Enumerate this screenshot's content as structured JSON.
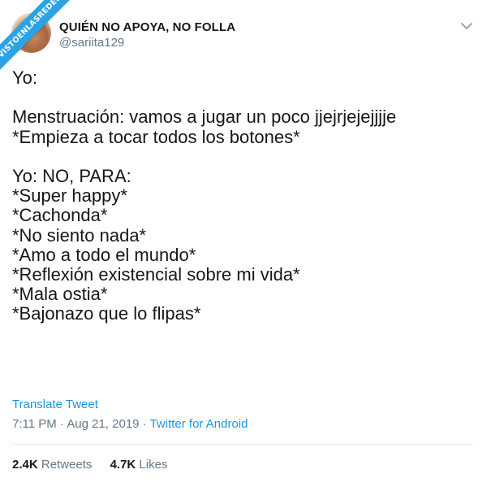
{
  "watermark": "VISTOENLASREDES",
  "author": {
    "name": "QUIÉN NO APOYA, NO FOLLA",
    "handle": "@sariita129"
  },
  "tweet": {
    "lines": [
      "Yo:",
      "",
      "Menstruación: vamos a jugar un poco jjejrjejejjjje",
      "*Empieza a tocar todos los botones*",
      "",
      "Yo: NO, PARA:",
      "*Super happy*",
      "*Cachonda*",
      "*No siento nada*",
      "*Amo a todo el mundo*",
      "*Reflexión existencial sobre mi vida*",
      "*Mala ostia*",
      "*Bajonazo que lo flipas*"
    ]
  },
  "translate_label": "Translate Tweet",
  "meta": {
    "time": "7:11 PM",
    "separator1": " · ",
    "date": "Aug 21, 2019",
    "separator2": " · ",
    "source": "Twitter for Android"
  },
  "stats": {
    "retweets_count": "2.4K",
    "retweets_label": "Retweets",
    "likes_count": "4.7K",
    "likes_label": "Likes"
  },
  "colors": {
    "link": "#1b95e0",
    "secondary_text": "#657786",
    "primary_text": "#14171a",
    "watermark_bg": "#2aa3e6"
  },
  "icons": {
    "menu": "chevron-down-icon"
  }
}
